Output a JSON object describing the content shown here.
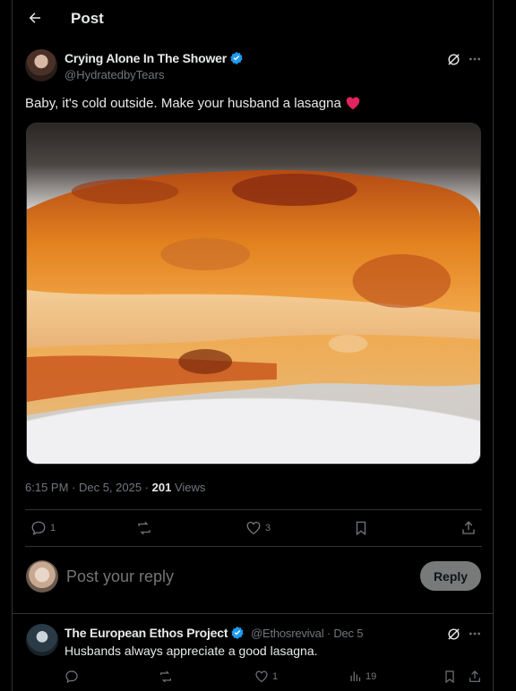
{
  "header": {
    "title": "Post"
  },
  "post": {
    "author_name": "Crying Alone In The Shower",
    "author_handle": "@HydratedbyTears",
    "text": "Baby, it's cold outside. Make your husband a lasagna",
    "emoji": "❤️",
    "time": "6:15 PM · Dec 5, 2025 · ",
    "views_count": "201",
    "views_label": " Views",
    "replies": "1",
    "likes": "3"
  },
  "reply_box": {
    "placeholder": "Post your reply",
    "button": "Reply"
  },
  "reply": {
    "author_name": "The European Ethos Project",
    "author_handle": "@Ethosrevival · Dec 5",
    "text": "Husbands always appreciate a good lasagna.",
    "likes": "1",
    "views": "19"
  },
  "colors": {
    "verified": "#1d9bf0",
    "background": "#000000",
    "muted": "#71767b"
  }
}
